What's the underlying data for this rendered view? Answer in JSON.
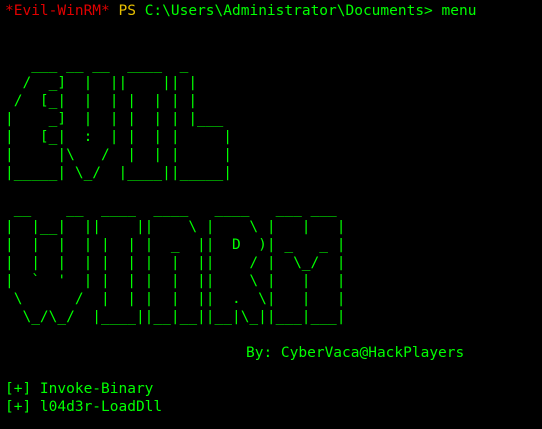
{
  "prompt": {
    "shell_tag": "*Evil-WinRM*",
    "ps_label": "PS",
    "path": "C:\\Users\\Administrator\\Documents>",
    "command": "menu"
  },
  "banner_lines": [
    "",
    "   ___ __ __  ____  _     ",
    "  /  _]  |  ||    || |    ",
    " /  [_|  |  | |  | | |    ",
    "|    _]  |  | |  | | |___ ",
    "|   [_|  :  | |  | |     |",
    "|     |\\   /  |  | |     |",
    "|_____| \\_/  |____||_____|",
    "",
    " __    __  ____  ____   ____   ___ ___ ",
    "|  |__|  ||    ||    \\ |    \\ |   |   |",
    "|  |  |  | |  | |  _  ||  D  )| _   _ |",
    "|  |  |  | |  | |  |  ||    / |  \\_/  |",
    "|  `  '  | |  | |  |  ||    \\ |   |   |",
    " \\      /  |  | |  |  ||  .  \\|   |   |",
    "  \\_/\\_/  |____||__|__||__|\\_||___|___|"
  ],
  "author": "By: CyberVaca@HackPlayers",
  "menu_items": [
    "[+] Invoke-Binary",
    "[+] l04d3r-LoadDll"
  ],
  "colors": {
    "background": "#000000",
    "text": "#00ff00",
    "shell_tag": "#e00000",
    "ps_label": "#e8c000"
  }
}
